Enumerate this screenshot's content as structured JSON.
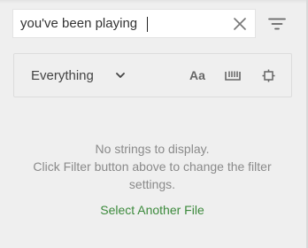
{
  "search": {
    "value": "you've been playing"
  },
  "options": {
    "scope_value": "Everything",
    "case_label": "Aa"
  },
  "empty_state": {
    "line1": "No strings to display.",
    "line2": "Click Filter button above to change the filter",
    "line3": "settings.",
    "link": "Select Another File"
  },
  "icons": {
    "clear": "close-icon",
    "filter": "filter-icon",
    "scope_dropdown": "chevron-down-icon",
    "whole_word": "whole-word-icon",
    "regex": "regex-icon"
  },
  "colors": {
    "background": "#efefef",
    "link": "#3c8a3c",
    "muted_text": "#8a8a8a",
    "icon": "#666666"
  }
}
